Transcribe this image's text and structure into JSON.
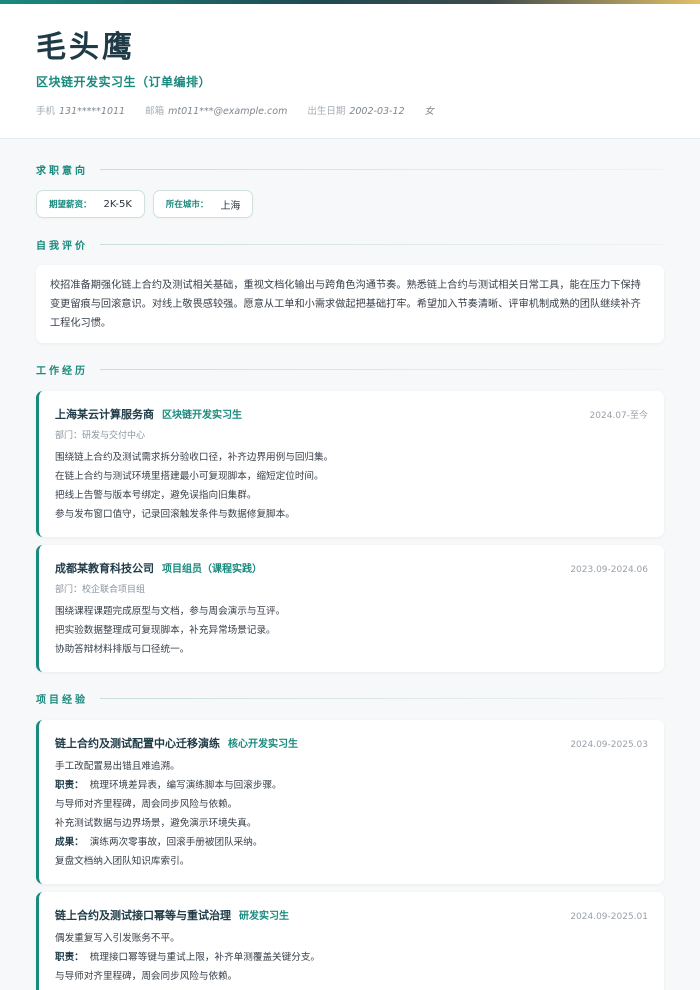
{
  "header": {
    "name": "毛头鹰",
    "role": "区块链开发实习生（订单编排）",
    "meta": [
      {
        "label": "手机",
        "value": "131*****1011"
      },
      {
        "label": "邮箱",
        "value": "mt011***@example.com"
      },
      {
        "label": "出生日期",
        "value": "2002-03-12"
      },
      {
        "label": "",
        "value": "女"
      }
    ]
  },
  "intent": {
    "title": "求职意向",
    "chips": [
      {
        "label": "期望薪资：",
        "value": "2K-5K"
      },
      {
        "label": "所在城市：",
        "value": "上海"
      }
    ]
  },
  "summary": {
    "title": "自我评价",
    "text": "校招准备期强化链上合约及测试相关基础，重视文档化输出与跨角色沟通节奏。熟悉链上合约与测试相关日常工具，能在压力下保持变更留痕与回滚意识。对线上敬畏感较强。愿意从工单和小需求做起把基础打牢。希望加入节奏清晰、评审机制成熟的团队继续补齐工程化习惯。"
  },
  "work": {
    "title": "工作经历",
    "items": [
      {
        "company": "上海某云计算服务商",
        "role": "区块链开发实习生",
        "date": "2024.07-至今",
        "dept": "部门：研发与交付中心",
        "bullets": [
          "围绕链上合约及测试需求拆分验收口径，补齐边界用例与回归集。",
          "在链上合约与测试环境里搭建最小可复现脚本，缩短定位时间。",
          "把线上告警与版本号绑定，避免误指向旧集群。",
          "参与发布窗口值守，记录回滚触发条件与数据修复脚本。"
        ]
      },
      {
        "company": "成都某教育科技公司",
        "role": "项目组员（课程实践）",
        "date": "2023.09-2024.06",
        "dept": "部门：校企联合项目组",
        "bullets": [
          "围绕课程课题完成原型与文档，参与周会演示与互评。",
          "把实验数据整理成可复现脚本，补充异常场景记录。",
          "协助答辩材料排版与口径统一。"
        ]
      }
    ]
  },
  "projects": {
    "title": "项目经验",
    "items": [
      {
        "name": "链上合约及测试配置中心迁移演练",
        "role": "核心开发实习生",
        "date": "2024.09-2025.03",
        "lead": "手工改配置易出错且难追溯。",
        "duty_label": "职责：",
        "duty": "梳理环境差异表，编写演练脚本与回滚步骤。",
        "duty_more": [
          "与导师对齐里程碑，周会同步风险与依赖。",
          "补充测试数据与边界场景，避免演示环境失真。"
        ],
        "result_label": "成果：",
        "result": "演练两次零事故，回滚手册被团队采纳。",
        "result_more": [
          "复盘文档纳入团队知识库索引。"
        ]
      },
      {
        "name": "链上合约及测试接口幂等与重试治理",
        "role": "研发实习生",
        "date": "2024.09-2025.01",
        "lead": "偶发重复写入引发账务不平。",
        "duty_label": "职责：",
        "duty": "梳理接口幂等键与重试上限，补齐单测覆盖关键分支。",
        "duty_more": [
          "与导师对齐里程碑，周会同步风险与依赖。"
        ]
      }
    ]
  }
}
